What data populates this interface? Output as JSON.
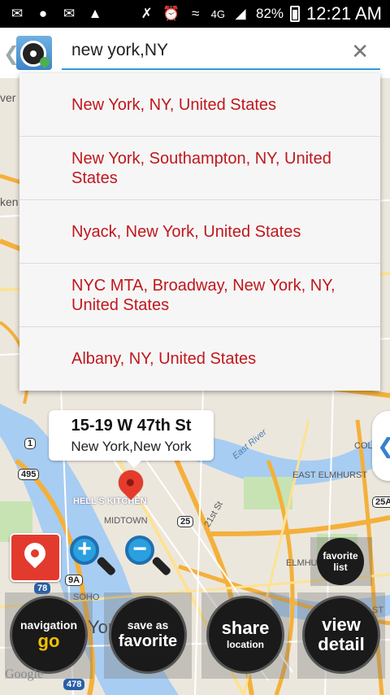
{
  "status_bar": {
    "time": "12:21 AM",
    "battery": "82%",
    "network": "4G"
  },
  "app_bar": {
    "search_value": "new york,NY",
    "search_placeholder": ""
  },
  "suggestions": [
    "New York, NY, United States",
    "New York, Southampton, NY, United States",
    "Nyack, New York, United States",
    "NYC MTA, Broadway, New York, NY, United States",
    "Albany, NY, United States"
  ],
  "callout": {
    "title": "15-19 W 47th St",
    "subtitle": "New York,New York"
  },
  "map_labels": {
    "hells_kitchen": "HELL'S KITCHEN",
    "midtown": "MIDTOWN",
    "east_elmhurst": "EAST ELMHURST",
    "elmhurst": "ELMHU",
    "soho": "SOHO",
    "york": "York",
    "east_river": "East River",
    "col": "COL",
    "st": "ST",
    "ver": "ver",
    "ken": "ken",
    "street_21": "21st St",
    "shield_1": "1",
    "shield_495": "495",
    "shield_25": "25",
    "shield_25a": "25A",
    "shield_9a": "9A",
    "shield_78": "78",
    "shield_478": "478",
    "google": "Google"
  },
  "buttons": {
    "favorite_list": [
      "favorite",
      "list"
    ],
    "navigation_go": [
      "navigation",
      "go"
    ],
    "save_as_favorite": [
      "save as",
      "favorite"
    ],
    "share_location": [
      "share",
      "location"
    ],
    "view_detail": [
      "view",
      "detail"
    ]
  },
  "colors": {
    "suggestion_text": "#c0171c",
    "search_underline": "#2e9ed6",
    "accent_red": "#e33a2e",
    "gold": "#f2c100"
  }
}
